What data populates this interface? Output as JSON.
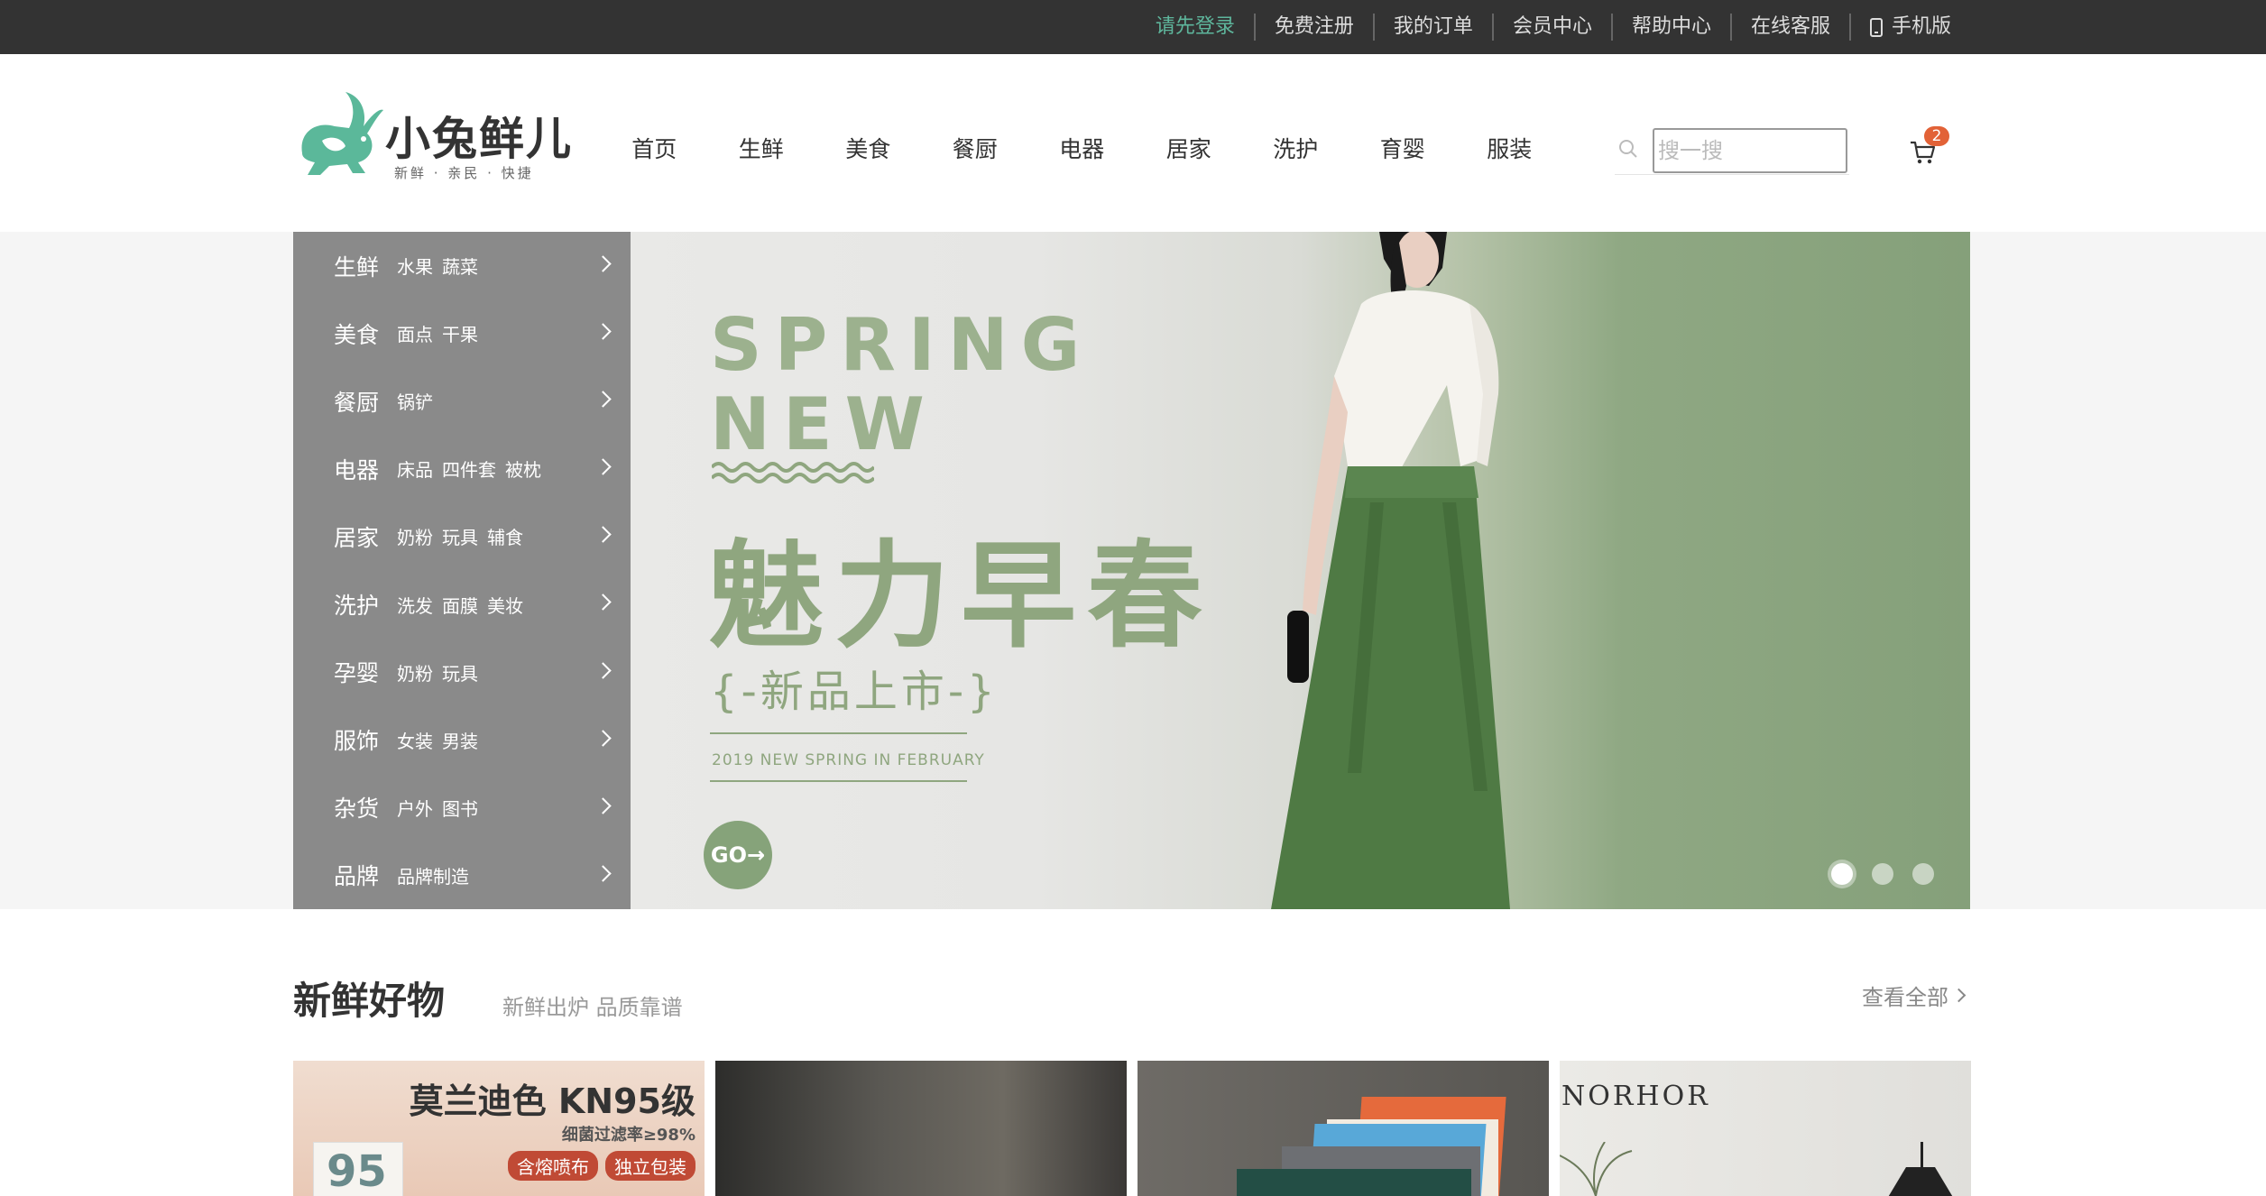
{
  "topbar": {
    "links": [
      "请先登录",
      "免费注册",
      "我的订单",
      "会员中心",
      "帮助中心",
      "在线客服"
    ],
    "mobile_label": "手机版"
  },
  "header": {
    "logo_name": "小兔鲜儿",
    "logo_slogan": "新鲜 · 亲民 · 快捷",
    "nav": [
      "首页",
      "生鲜",
      "美食",
      "餐厨",
      "电器",
      "居家",
      "洗护",
      "育婴",
      "服装"
    ],
    "search_placeholder": "搜一搜",
    "cart_count": "2"
  },
  "categories": [
    {
      "name": "生鲜",
      "subs": [
        "水果",
        "蔬菜"
      ]
    },
    {
      "name": "美食",
      "subs": [
        "面点",
        "干果"
      ]
    },
    {
      "name": "餐厨",
      "subs": [
        "锅铲"
      ]
    },
    {
      "name": "电器",
      "subs": [
        "床品",
        "四件套",
        "被枕"
      ]
    },
    {
      "name": "居家",
      "subs": [
        "奶粉",
        "玩具",
        "辅食"
      ]
    },
    {
      "name": "洗护",
      "subs": [
        "洗发",
        "面膜",
        "美妆"
      ]
    },
    {
      "name": "孕婴",
      "subs": [
        "奶粉",
        "玩具"
      ]
    },
    {
      "name": "服饰",
      "subs": [
        "女装",
        "男装"
      ]
    },
    {
      "name": "杂货",
      "subs": [
        "户外",
        "图书"
      ]
    },
    {
      "name": "品牌",
      "subs": [
        "品牌制造"
      ]
    }
  ],
  "banner": {
    "line1": "SPRING",
    "line2": "NEW",
    "slogan": "魅力早春",
    "sub_slogan": "{-新品上市-}",
    "tagline": "2019 NEW SPRING IN FEBRUARY",
    "go_label": "GO→",
    "slide_count": 3,
    "active_slide": 1
  },
  "section": {
    "title": "新鲜好物",
    "subtitle": "新鲜出炉 品质靠谱",
    "view_all": "查看全部"
  },
  "goods": {
    "item1_title": "莫兰迪色 KN95级",
    "item1_sub": "细菌过滤率≥98%",
    "item1_tags": [
      "含熔喷布",
      "独立包装"
    ],
    "item1_box_mark": "95",
    "item4_brand": "NORHOR"
  },
  "colors": {
    "topbar_bg": "#333333",
    "accent_green": "#5eb69c",
    "badge": "#e26237",
    "category_bg": "#8a8a8a"
  }
}
